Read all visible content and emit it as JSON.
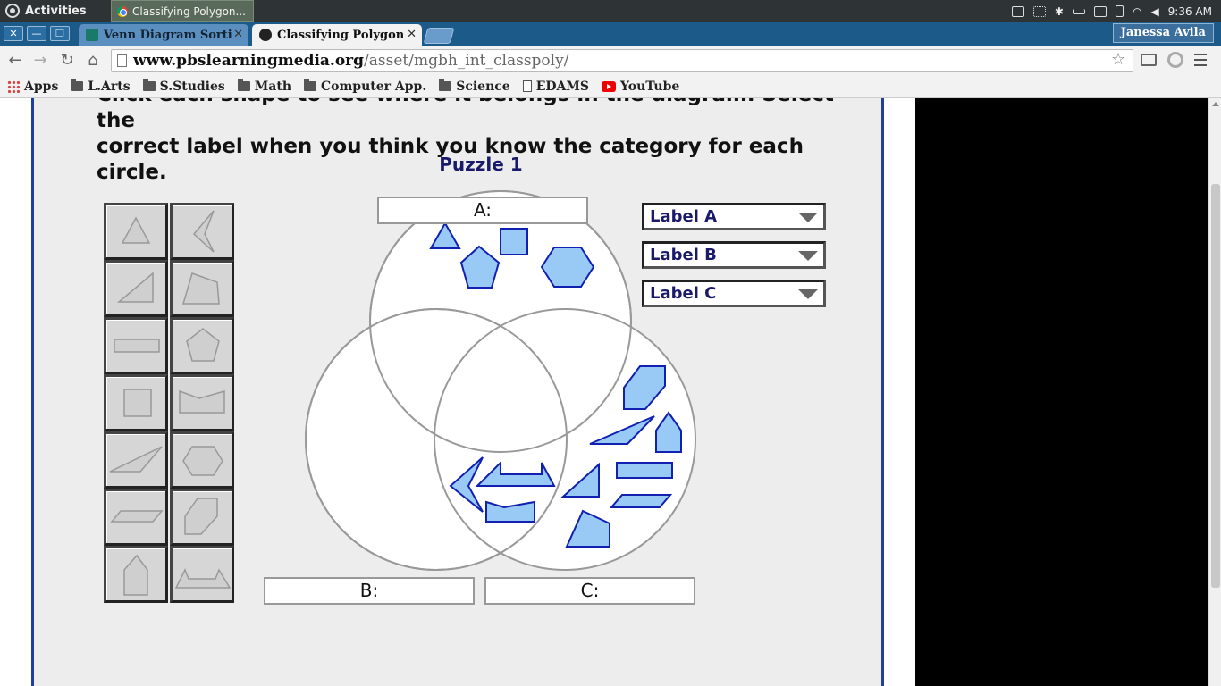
{
  "system_bar": {
    "activities_label": "Activities",
    "app_tab_title": "Classifying Polygon...",
    "clock": "9:36 AM"
  },
  "browser": {
    "tabs": [
      {
        "label": "Venn Diagram Sorti",
        "icon": "classroom-icon"
      },
      {
        "label": "Classifying Polygon",
        "icon": "pbs-icon"
      }
    ],
    "user_name": "Janessa Avila",
    "url_host": "www.pbslearningmedia.org",
    "url_path": "/asset/mgbh_int_classpoly/",
    "bookmarks": [
      {
        "label": "Apps",
        "icon": "apps-icon"
      },
      {
        "label": "L.Arts",
        "icon": "folder-icon"
      },
      {
        "label": "S.Studies",
        "icon": "folder-icon"
      },
      {
        "label": "Math",
        "icon": "folder-icon"
      },
      {
        "label": "Computer App.",
        "icon": "folder-icon"
      },
      {
        "label": "Science",
        "icon": "folder-icon"
      },
      {
        "label": "EDAMS",
        "icon": "page-icon"
      },
      {
        "label": "YouTube",
        "icon": "youtube-icon"
      }
    ]
  },
  "activity": {
    "instructions_line1": "Click each shape to see where it belongs in the diagram. Select the",
    "instructions_line2": "correct label when you think you know the category for each circle.",
    "puzzle_title": "Puzzle 1",
    "circle_labels": {
      "a": "A:",
      "b": "B:",
      "c": "C:"
    },
    "dropdowns": {
      "a": "Label A",
      "b": "Label B",
      "c": "Label C"
    },
    "shape_tray_rows": 7,
    "shape_color_fill": "#99c9f5",
    "shape_color_stroke": "#1020b0",
    "tray_shape_fill": "#cfcfcf",
    "tray_shape_stroke": "#999999"
  }
}
